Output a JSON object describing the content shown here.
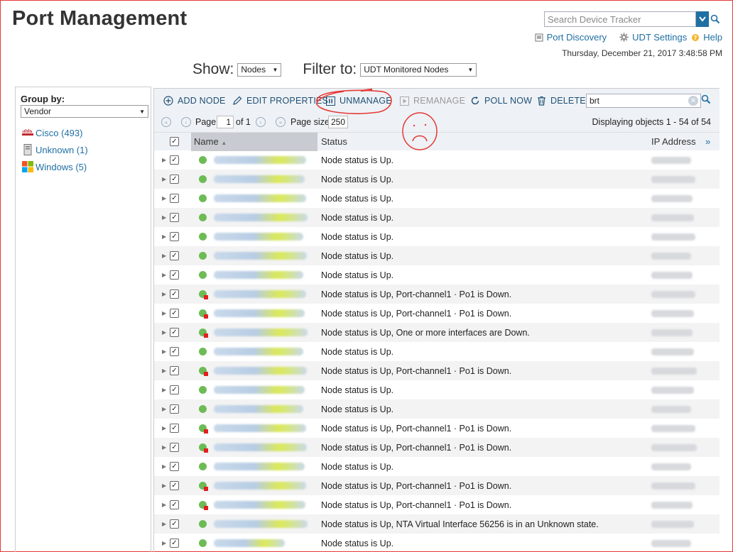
{
  "page": {
    "title": "Port Management"
  },
  "header": {
    "search_placeholder": "Search Device Tracker",
    "links": {
      "port_discovery": "Port Discovery",
      "udt_settings": "UDT Settings",
      "help": "Help"
    },
    "datetime": "Thursday, December 21, 2017 3:48:58 PM"
  },
  "filters": {
    "show_label": "Show:",
    "show_value": "Nodes",
    "filter_label": "Filter to:",
    "filter_value": "UDT Monitored Nodes"
  },
  "sidebar": {
    "group_by_label": "Group by:",
    "group_by_value": "Vendor",
    "vendors": [
      {
        "label": "Cisco (493)",
        "icon": "cisco-logo-icon"
      },
      {
        "label": "Unknown (1)",
        "icon": "server-icon"
      },
      {
        "label": "Windows (5)",
        "icon": "windows-logo-icon"
      }
    ]
  },
  "toolbar": {
    "add_node": "ADD NODE",
    "edit_properties": "EDIT PROPERTIES",
    "unmanage": "UNMANAGE",
    "remanage": "REMANAGE",
    "poll_now": "POLL NOW",
    "delete": "DELETE",
    "search_value": "brt"
  },
  "pager": {
    "page_label": "Page",
    "page_value": "1",
    "of_label": "of 1",
    "page_size_label": "Page size",
    "page_size_value": "250",
    "displaying": "Displaying objects 1 - 54 of 54"
  },
  "columns": {
    "name": "Name",
    "status": "Status",
    "ip": "IP Address"
  },
  "rows": [
    {
      "status": "Node status is Up.",
      "warn": false
    },
    {
      "status": "Node status is Up.",
      "warn": false
    },
    {
      "status": "Node status is Up.",
      "warn": false
    },
    {
      "status": "Node status is Up.",
      "warn": false
    },
    {
      "status": "Node status is Up.",
      "warn": false
    },
    {
      "status": "Node status is Up.",
      "warn": false
    },
    {
      "status": "Node status is Up.",
      "warn": false
    },
    {
      "status": "Node status is Up, Port-channel1 · Po1 is Down.",
      "warn": true
    },
    {
      "status": "Node status is Up, Port-channel1 · Po1 is Down.",
      "warn": true
    },
    {
      "status": "Node status is Up, One or more interfaces are Down.",
      "warn": true
    },
    {
      "status": "Node status is Up.",
      "warn": false
    },
    {
      "status": "Node status is Up, Port-channel1 · Po1 is Down.",
      "warn": true
    },
    {
      "status": "Node status is Up.",
      "warn": false
    },
    {
      "status": "Node status is Up.",
      "warn": false
    },
    {
      "status": "Node status is Up, Port-channel1 · Po1 is Down.",
      "warn": true
    },
    {
      "status": "Node status is Up, Port-channel1 · Po1 is Down.",
      "warn": true
    },
    {
      "status": "Node status is Up.",
      "warn": false
    },
    {
      "status": "Node status is Up, Port-channel1 · Po1 is Down.",
      "warn": true
    },
    {
      "status": "Node status is Up, Port-channel1 · Po1 is Down.",
      "warn": true
    },
    {
      "status": "Node status is Up, NTA Virtual Interface 56256 is in an Unknown state.",
      "warn": false
    },
    {
      "status": "Node status is Up.",
      "warn": false
    }
  ],
  "colors": {
    "link": "#1f6fa3",
    "status_up": "#6dbb55",
    "status_warn": "#e02020",
    "annotation": "#e53935"
  }
}
